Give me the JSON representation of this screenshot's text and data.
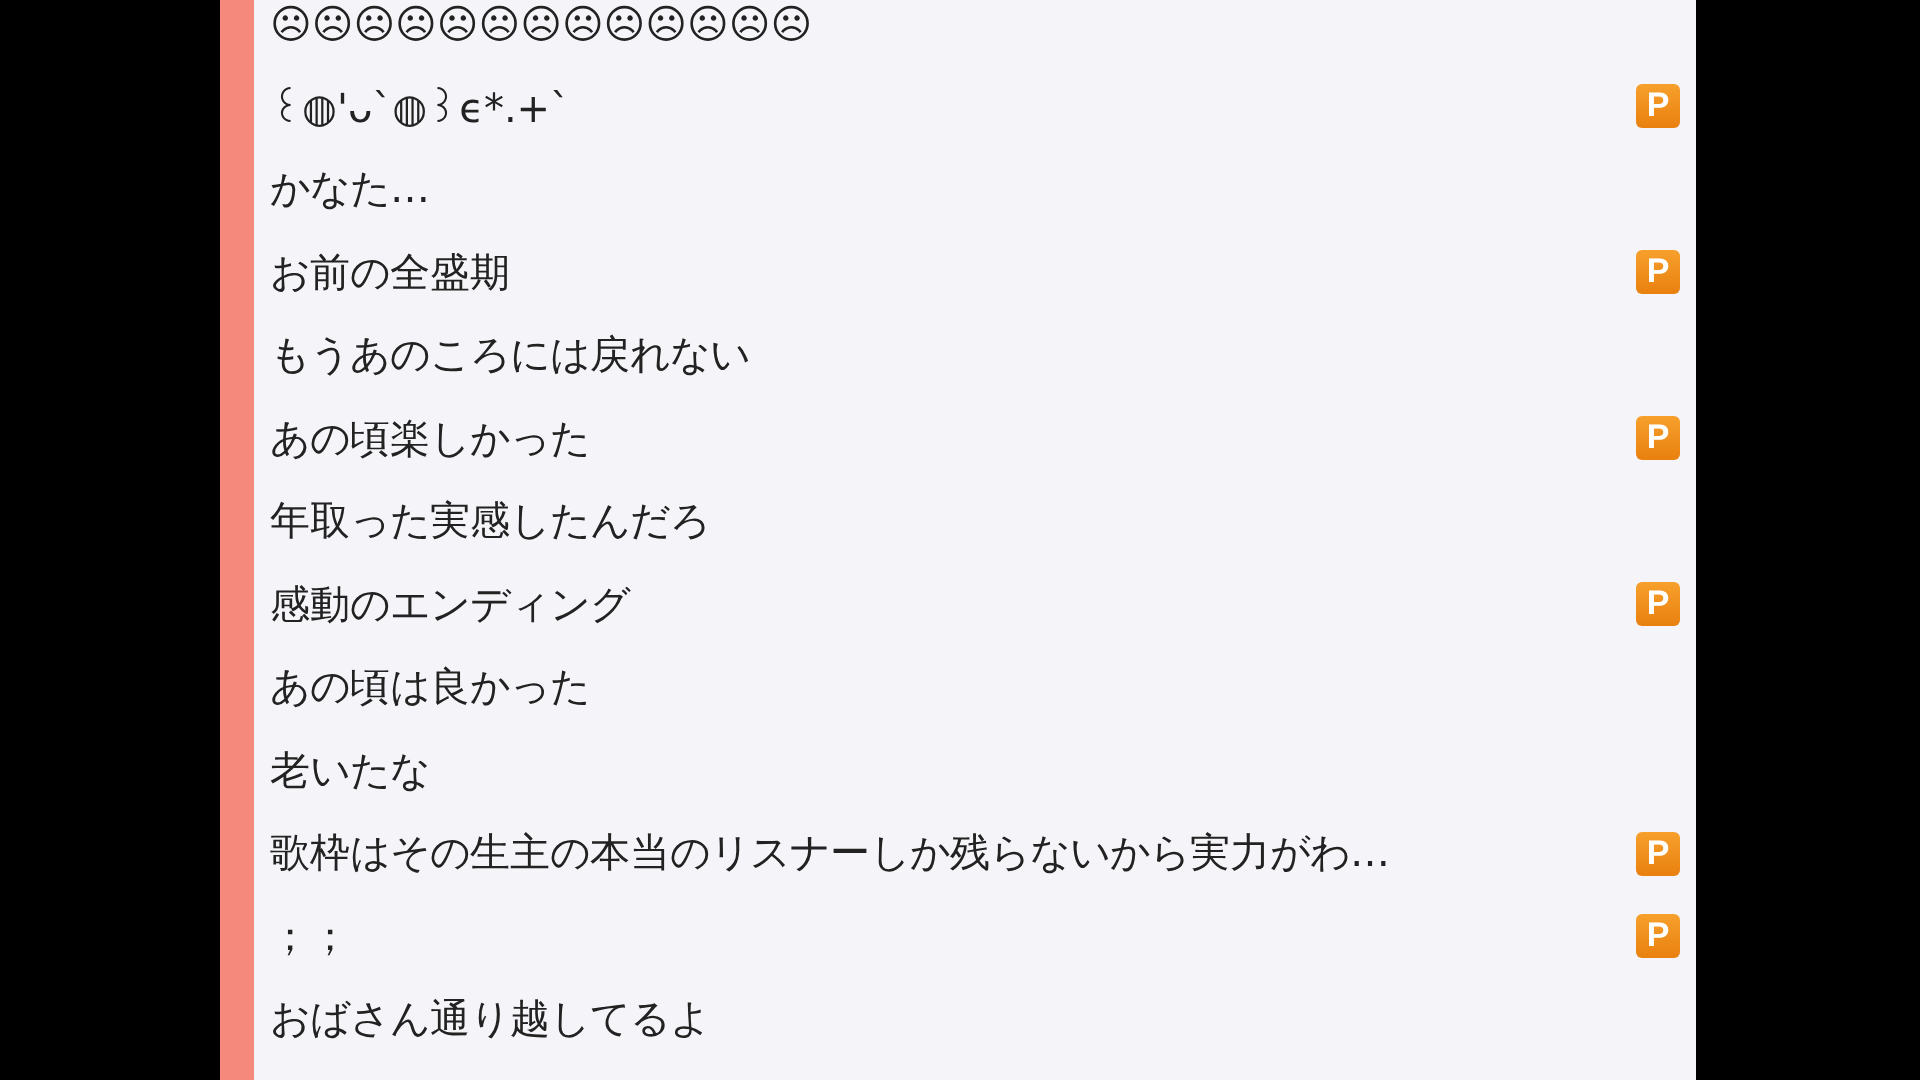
{
  "comments": [
    {
      "text": "☹☹☹☹☹☹☹☹☹☹☹☹☹"
    },
    {
      "text": "꒰◍'ᴗ`◍꒱ϵ*.+`",
      "badge": "P"
    },
    {
      "text": "かなた…"
    },
    {
      "text": "お前の全盛期",
      "badge": "P"
    },
    {
      "text": "もうあのころには戻れない"
    },
    {
      "text": "あの頃楽しかった",
      "badge": "P"
    },
    {
      "text": "年取った実感したんだろ"
    },
    {
      "text": "感動のエンディング",
      "badge": "P"
    },
    {
      "text": "あの頃は良かった"
    },
    {
      "text": "老いたな"
    },
    {
      "text": "歌枠はその生主の本当のリスナーしか残らないから実力がわ…",
      "badge": "P"
    },
    {
      "text": "；；",
      "badge": "P"
    },
    {
      "text": "おばさん通り越してるよ"
    }
  ]
}
